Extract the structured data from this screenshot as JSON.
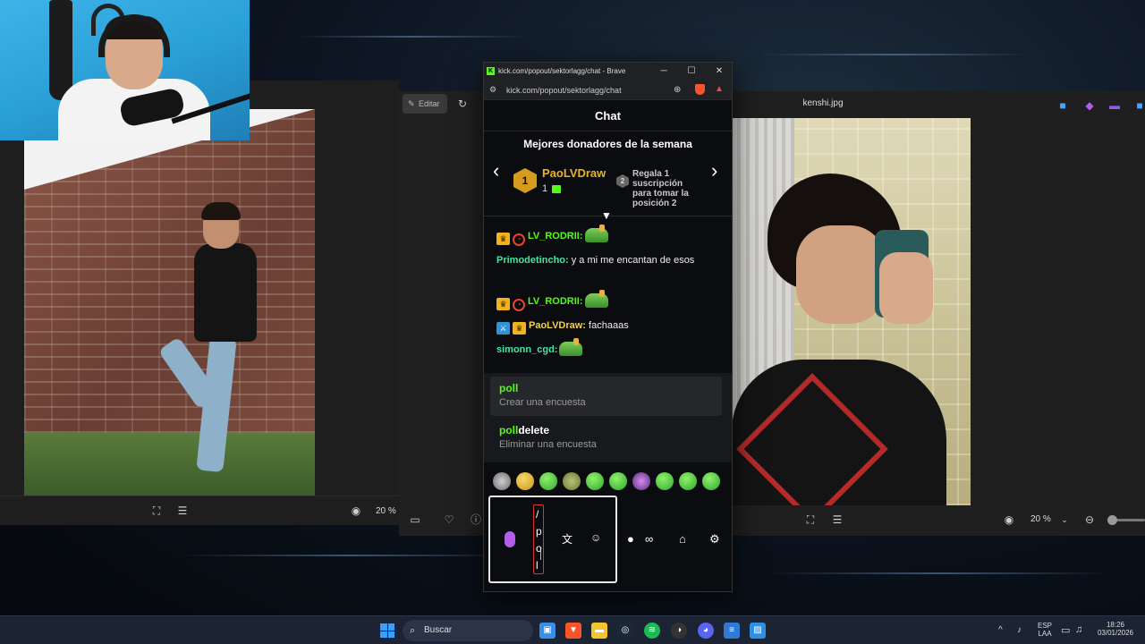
{
  "browser": {
    "window_title": "kick.com/popout/sektorlagg/chat - Brave",
    "url": "kick.com/popout/sektorlagg/chat",
    "minimize": "─",
    "maximize": "☐",
    "close": "✕"
  },
  "chat": {
    "header": "Chat",
    "donors": {
      "title": "Mejores donadores de la semana",
      "first_rank": "1",
      "first_name": "PaoLVDraw",
      "first_count": "1",
      "second_rank": "2",
      "second_hint": "Regala 1 suscripción para tomar la posición 2"
    },
    "messages": [
      {
        "user": "LV_RODRII:",
        "text": ""
      },
      {
        "user": "Primodetincho:",
        "text": "y a mi me encantan de esos"
      },
      {
        "user": "LV_RODRII:",
        "text": ""
      },
      {
        "user": "PaoLVDraw:",
        "text": "fachaaas"
      },
      {
        "user": "simonn_cgd:",
        "text": ""
      }
    ],
    "suggestions": [
      {
        "match": "poll",
        "rest": "",
        "desc": "Crear una encuesta"
      },
      {
        "match": "poll",
        "rest": "delete",
        "desc": "Eliminar una encuesta"
      }
    ],
    "input_chars": [
      "/",
      "p",
      "o",
      "l"
    ]
  },
  "photos_left": {
    "edit_label": "Editar",
    "zoom": "20 %"
  },
  "photos_right": {
    "file_title": "kenshi.jpg",
    "zoom": "20 %"
  },
  "taskbar": {
    "search_label": "Buscar",
    "lang_top": "ESP",
    "lang_bottom": "LAA",
    "time": "18:26",
    "date": "03/01/2026"
  },
  "colors": {
    "kick_green": "#53fc18",
    "donor_gold": "#e8b229"
  }
}
